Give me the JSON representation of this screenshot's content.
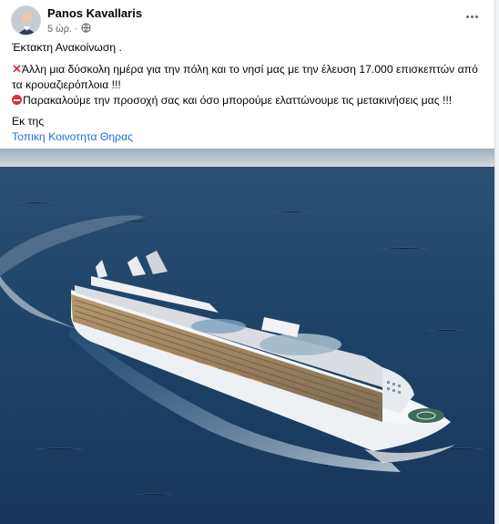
{
  "post": {
    "author": "Panos Kavallaris",
    "time": "5 ώρ.",
    "separator": "·",
    "privacy_icon": "globe-icon",
    "more_icon": "more-options-icon",
    "line1": "Έκτακτη Ανακοίνωση .",
    "line2": "Άλλη μια δύσκολη ημέρα για την πόλη και το νησί μας με την έλευση 17.000 επισκεπτών από τα κρουαζιερόπλοια !!!",
    "line3": "Παρακαλούμε την προσοχή σας και όσο μπορούμε ελαττώνουμε τις μετακινήσεις μας !!!",
    "line4": "Εκ της",
    "link": "Τοπικη Κοινοτητα Θηρας"
  },
  "colors": {
    "link": "#216fdb",
    "sea": "#1d3f63",
    "sky": "#c9d2d8",
    "hull": "#ffffff"
  }
}
